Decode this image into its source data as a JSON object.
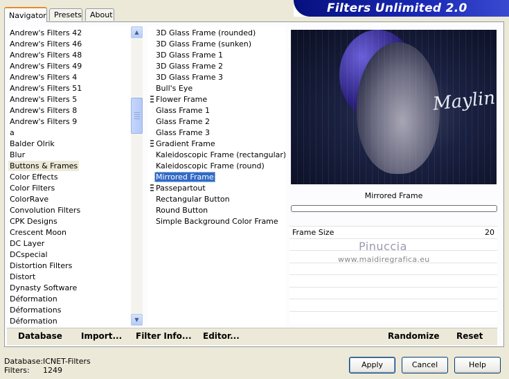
{
  "title": "Filters Unlimited 2.0",
  "tabs": [
    {
      "label": "Navigator"
    },
    {
      "label": "Presets"
    },
    {
      "label": "About"
    }
  ],
  "categories": [
    "Andrew's Filters 42",
    "Andrew's Filters 46",
    "Andrew's Filters 48",
    "Andrew's Filters 49",
    "Andrew's Filters 4",
    "Andrew's Filters 51",
    "Andrew's Filters 5",
    "Andrew's Filters 8",
    "Andrew's Filters 9",
    "a",
    "Balder Olrik",
    "Blur",
    "Buttons & Frames",
    "Color Effects",
    "Color Filters",
    "ColorRave",
    "Convolution Filters",
    "CPK Designs",
    "Crescent Moon",
    "DC Layer",
    "DCspecial",
    "Distortion Filters",
    "Distort",
    "Dynasty Software",
    "Déformation",
    "Déformations",
    "Déformation"
  ],
  "selected_category": "Buttons & Frames",
  "filters": [
    {
      "label": "3D Glass Frame (rounded)",
      "marked": false
    },
    {
      "label": "3D Glass Frame (sunken)",
      "marked": false
    },
    {
      "label": "3D Glass Frame 1",
      "marked": false
    },
    {
      "label": "3D Glass Frame 2",
      "marked": false
    },
    {
      "label": "3D Glass Frame 3",
      "marked": false
    },
    {
      "label": "Bull's Eye",
      "marked": false
    },
    {
      "label": "Flower Frame",
      "marked": true
    },
    {
      "label": "Glass Frame 1",
      "marked": false
    },
    {
      "label": "Glass Frame 2",
      "marked": false
    },
    {
      "label": "Glass Frame 3",
      "marked": false
    },
    {
      "label": "Gradient Frame",
      "marked": true
    },
    {
      "label": "Kaleidoscopic Frame (rectangular)",
      "marked": false
    },
    {
      "label": "Kaleidoscopic Frame (round)",
      "marked": false
    },
    {
      "label": "Mirrored Frame",
      "marked": false
    },
    {
      "label": "Passepartout",
      "marked": true
    },
    {
      "label": "Rectangular Button",
      "marked": false
    },
    {
      "label": "Round Button",
      "marked": false
    },
    {
      "label": "Simple Background Color Frame",
      "marked": false
    }
  ],
  "selected_filter": "Mirrored Frame",
  "preview": {
    "signature": "Maylin"
  },
  "current_filter_name": "Mirrored Frame",
  "progress": 0,
  "params": [
    {
      "name": "Frame Size",
      "value": "20"
    }
  ],
  "watermark": {
    "name": "Pinuccia",
    "url": "www.maidiregrafica.eu"
  },
  "toolbar": {
    "database": "Database",
    "import": "Import...",
    "filter_info": "Filter Info...",
    "editor": "Editor...",
    "randomize": "Randomize",
    "reset": "Reset"
  },
  "status": {
    "database_label": "Database:",
    "database_value": "ICNET-Filters",
    "filters_label": "Filters:",
    "filters_value": "1249"
  },
  "buttons": {
    "apply": "Apply",
    "cancel": "Cancel",
    "help": "Help"
  },
  "colors": {
    "banner": "#1a29b5",
    "selection": "#316ac5",
    "tab_accent": "#e68b2c"
  }
}
